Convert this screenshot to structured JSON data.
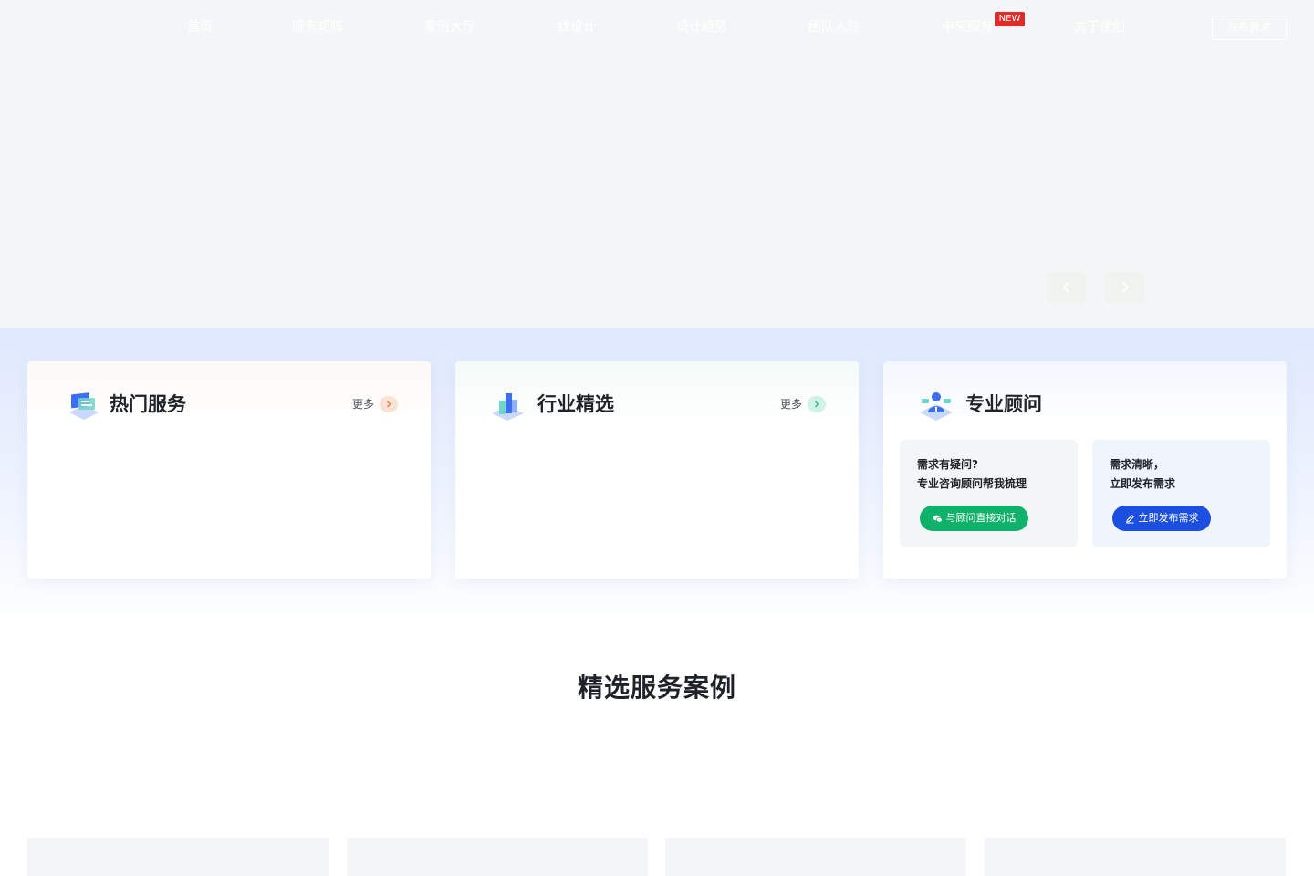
{
  "nav": {
    "items": [
      "首页",
      "服务矩阵",
      "案例大厅",
      "找设计",
      "设计趋势",
      "团队入驻",
      "申奖服务",
      "关于优创"
    ],
    "new_badge": "NEW",
    "publish_button": "发布需求"
  },
  "hero": {
    "prev_icon": "chevron-left-icon",
    "next_icon": "chevron-right-icon"
  },
  "cards": {
    "hot": {
      "title": "热门服务",
      "more": "更多",
      "icon": "laptop-icon",
      "accent": "#f6c9a6"
    },
    "industry": {
      "title": "行业精选",
      "more": "更多",
      "icon": "buildings-icon",
      "accent": "#bfeedd"
    },
    "consultant": {
      "title": "专业顾问",
      "icon": "consultant-icon",
      "ask": {
        "line1": "需求有疑问?",
        "line2": "专业咨询顾问帮我梳理",
        "button": "与顾问直接对话",
        "icon": "wechat-icon"
      },
      "publish": {
        "line1": "需求清晰，",
        "line2": "立即发布需求",
        "button": "立即发布需求",
        "icon": "pencil-icon"
      }
    }
  },
  "section": {
    "title": "精选服务案例"
  },
  "colors": {
    "green": "#10b16a",
    "blue": "#1c4fe0",
    "badge_red": "#e02b2b"
  }
}
